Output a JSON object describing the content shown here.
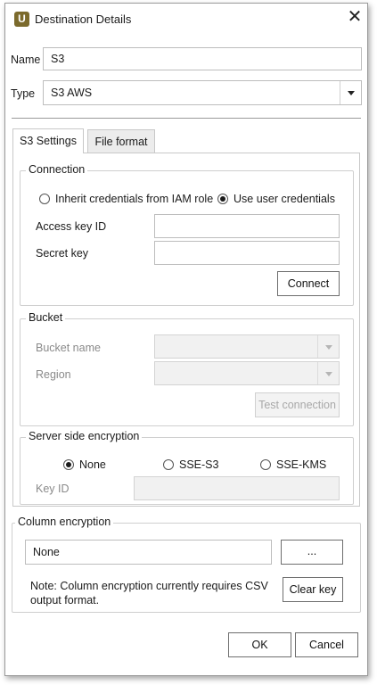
{
  "window": {
    "app_icon_letter": "U",
    "title": "Destination Details",
    "close_symbol": "✕"
  },
  "form": {
    "name_label": "Name",
    "name_value": "S3",
    "type_label": "Type",
    "type_value": "S3 AWS"
  },
  "tabs": [
    {
      "label": "S3 Settings",
      "active": true
    },
    {
      "label": "File format",
      "active": false
    }
  ],
  "connection": {
    "title": "Connection",
    "radio_iam_label": "Inherit credentials from IAM role",
    "radio_user_label": "Use user credentials",
    "selected": "user",
    "access_key_label": "Access key ID",
    "access_key_value": "",
    "secret_key_label": "Secret key",
    "secret_key_value": "",
    "connect_label": "Connect"
  },
  "bucket": {
    "title": "Bucket",
    "bucket_name_label": "Bucket name",
    "bucket_name_value": "",
    "region_label": "Region",
    "region_value": "",
    "test_connection_label": "Test connection"
  },
  "encryption": {
    "title": "Server side encryption",
    "option_none": "None",
    "option_sse_s3": "SSE-S3",
    "option_sse_kms": "SSE-KMS",
    "selected": "None",
    "key_id_label": "Key ID",
    "key_id_value": ""
  },
  "column_encryption": {
    "title": "Column encryption",
    "value": "None",
    "browse_label": "...",
    "note_line1": "Note: Column encryption currently requires CSV",
    "note_line2": "output format.",
    "clear_label": "Clear key"
  },
  "footer": {
    "ok_label": "OK",
    "cancel_label": "Cancel"
  },
  "colors": {
    "app_icon": "#7b6a2c",
    "border": "#9a9a9a",
    "disabled_field": "#f1f1f1"
  }
}
